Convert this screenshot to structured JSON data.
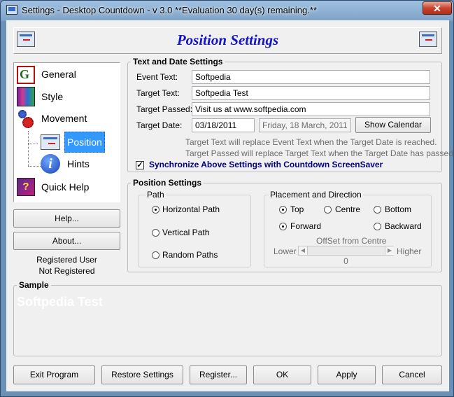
{
  "window": {
    "title": "Settings - Desktop Countdown - v 3.0  **Evaluation 30 day(s) remaining.**",
    "close_glyph": "✕"
  },
  "header": {
    "title": "Position Settings"
  },
  "nav": {
    "items": [
      {
        "label": "General",
        "icon": "general-icon"
      },
      {
        "label": "Style",
        "icon": "style-icon"
      },
      {
        "label": "Movement",
        "icon": "gears-icon"
      },
      {
        "label": "Position",
        "icon": "monitor-icon",
        "selected": true
      },
      {
        "label": "Hints",
        "icon": "info-icon"
      },
      {
        "label": "Quick Help",
        "icon": "help-book-icon"
      }
    ]
  },
  "left_buttons": {
    "help": "Help...",
    "about": "About..."
  },
  "registration": {
    "line1": "Registered User",
    "line2": "Not Registered"
  },
  "text_date": {
    "group_title": "Text and Date Settings",
    "event_text_label": "Event Text:",
    "event_text_value": "Softpedia",
    "target_text_label": "Target Text:",
    "target_text_value": "Softpedia Test",
    "target_passed_label": "Target Passed:",
    "target_passed_value": "Visit us at www.softpedia.com",
    "target_date_label": "Target Date:",
    "target_date_value": "03/18/2011",
    "target_date_long": "Friday, 18 March, 2011",
    "show_calendar": "Show Calendar",
    "hint1": "Target Text will replace Event Text when the Target Date is reached.",
    "hint2": "Target Passed will replace Target Text when the Target Date has passed.",
    "sync_label": "Synchronize Above Settings with Countdown ScreenSaver",
    "sync_checked": true
  },
  "position": {
    "group_title": "Position Settings",
    "path": {
      "title": "Path",
      "options": [
        "Horizontal Path",
        "Vertical Path",
        "Random Paths"
      ],
      "selected": "Horizontal Path"
    },
    "placement": {
      "title": "Placement and Direction",
      "vertical_options": [
        "Top",
        "Centre",
        "Bottom"
      ],
      "vertical_selected": "Top",
      "direction_options": [
        "Forward",
        "Backward"
      ],
      "direction_selected": "Forward",
      "offset_title": "OffSet from Centre",
      "lower": "Lower",
      "higher": "Higher",
      "offset_value": "0"
    }
  },
  "sample": {
    "title": "Sample",
    "text": "Softpedia Test",
    "bg_color": "#f0f0f0",
    "text_color": "#ffffff"
  },
  "bottom_buttons": {
    "exit": "Exit Program",
    "restore": "Restore Settings",
    "register": "Register...",
    "ok": "OK",
    "apply": "Apply",
    "cancel": "Cancel"
  },
  "colors": {
    "header_title": "#1414c8",
    "selection": "#3399ff",
    "sync_text": "#000080"
  }
}
